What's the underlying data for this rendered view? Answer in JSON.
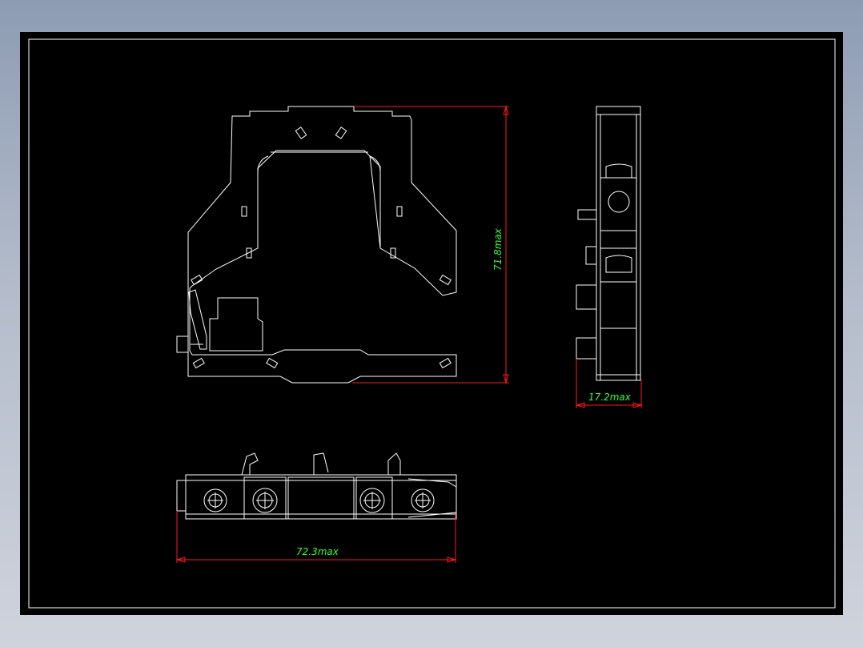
{
  "drawing": {
    "background": "#000000",
    "line_color": "#ffffff",
    "dimension_line_color": "#ff1a1a",
    "dimension_text_color": "#33ff33",
    "dimensions": {
      "height": "71.8max",
      "depth": "17.2max",
      "width": "72.3max"
    }
  }
}
